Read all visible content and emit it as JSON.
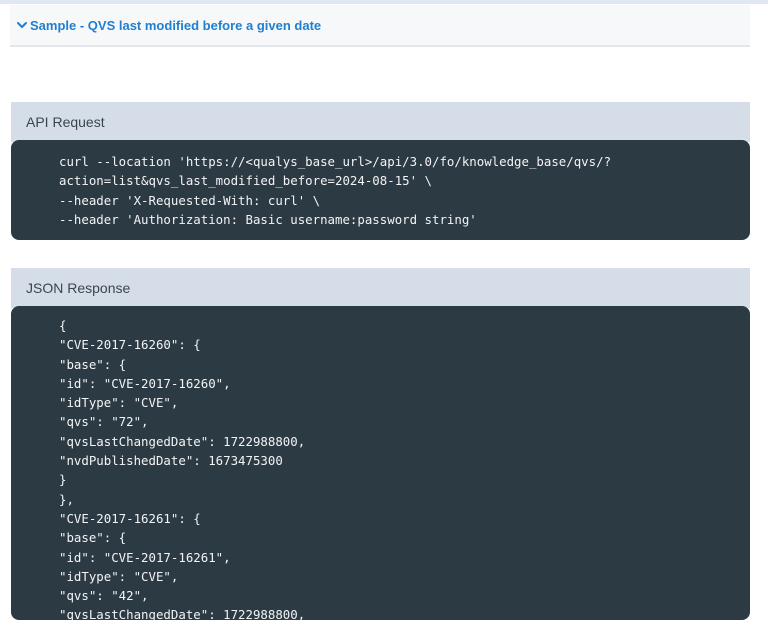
{
  "sample": {
    "title": "Sample - QVS last modified before a given date"
  },
  "api_request": {
    "heading": "API Request",
    "lines": [
      "curl --location 'https://<qualys_base_url>/api/3.0/fo/knowledge_base/qvs/?",
      "action=list&qvs_last_modified_before=2024-08-15' \\",
      "--header 'X-Requested-With: curl' \\",
      "--header 'Authorization: Basic username:password string'"
    ]
  },
  "json_response": {
    "heading": "JSON Response",
    "lines": [
      "{",
      "\"CVE-2017-16260\": {",
      "\"base\": {",
      "\"id\": \"CVE-2017-16260\",",
      "\"idType\": \"CVE\",",
      "\"qvs\": \"72\",",
      "\"qvsLastChangedDate\": 1722988800,",
      "\"nvdPublishedDate\": 1673475300",
      "}",
      "},",
      "\"CVE-2017-16261\": {",
      "\"base\": {",
      "\"id\": \"CVE-2017-16261\",",
      "\"idType\": \"CVE\",",
      "\"qvs\": \"42\",",
      "\"qvsLastChangedDate\": 1722988800,"
    ]
  },
  "colors": {
    "link": "#1f7fd0",
    "section_header_bg": "#d5dee8",
    "code_bg": "#2c3a43",
    "code_text": "#f2f4f6"
  },
  "icons": {
    "collapse": "chevron-down-icon"
  }
}
